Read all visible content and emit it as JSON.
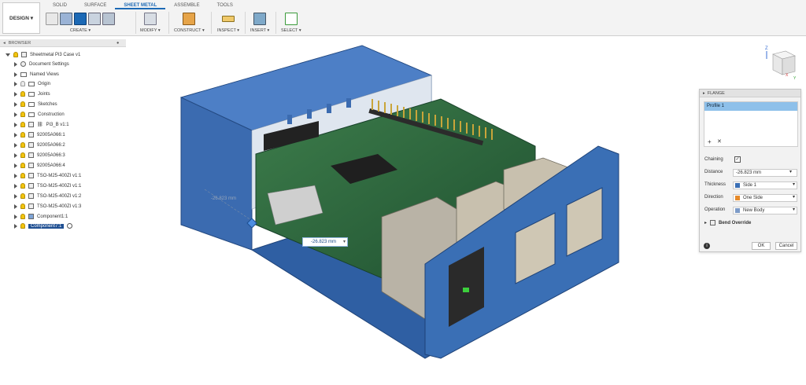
{
  "toolbar": {
    "design_label": "DESIGN",
    "tabs": [
      "SOLID",
      "SURFACE",
      "SHEET METAL",
      "ASSEMBLE",
      "TOOLS"
    ],
    "groups": {
      "create": "CREATE",
      "modify": "MODIFY",
      "construct": "CONSTRUCT",
      "inspect": "INSPECT",
      "insert": "INSERT",
      "select": "SELECT"
    }
  },
  "browser": {
    "title": "BROWSER",
    "root": "Sheetmetal Pi3 Case v1",
    "items": [
      "Document Settings",
      "Named Views",
      "Origin",
      "Joints",
      "Sketches",
      "Construction",
      "Pi3_B v1:1",
      "92005A066:1",
      "92005A066:2",
      "92005A066:3",
      "92005A066:4",
      "TSO-M25-400ZI v1:1",
      "TSO-M25-400ZI v1:1",
      "TSO-M25-400ZI v1:2",
      "TSO-M25-400ZI v1:3",
      "Component1:1",
      "Component7:1"
    ]
  },
  "flange": {
    "title": "FLANGE",
    "profile": "Profile 1",
    "chaining_label": "Chaining",
    "distance_label": "Distance",
    "distance_value": "-26.823 mm",
    "thickness_label": "Thickness",
    "thickness_value": "Side 1",
    "direction_label": "Direction",
    "direction_value": "One Side",
    "operation_label": "Operation",
    "operation_value": "New Body",
    "bend_override": "Bend Override",
    "ok": "OK",
    "cancel": "Cancel"
  },
  "viewport": {
    "dimension_value": "-26.823 mm",
    "axis_z": "Z",
    "axis_x": "X",
    "axis_y": "Y"
  },
  "colors": {
    "case_blue": "#3a6fb5",
    "pcb_green": "#2d6b3d",
    "selection_blue": "#1f4f92",
    "profile_highlight": "#8ec0ea"
  }
}
